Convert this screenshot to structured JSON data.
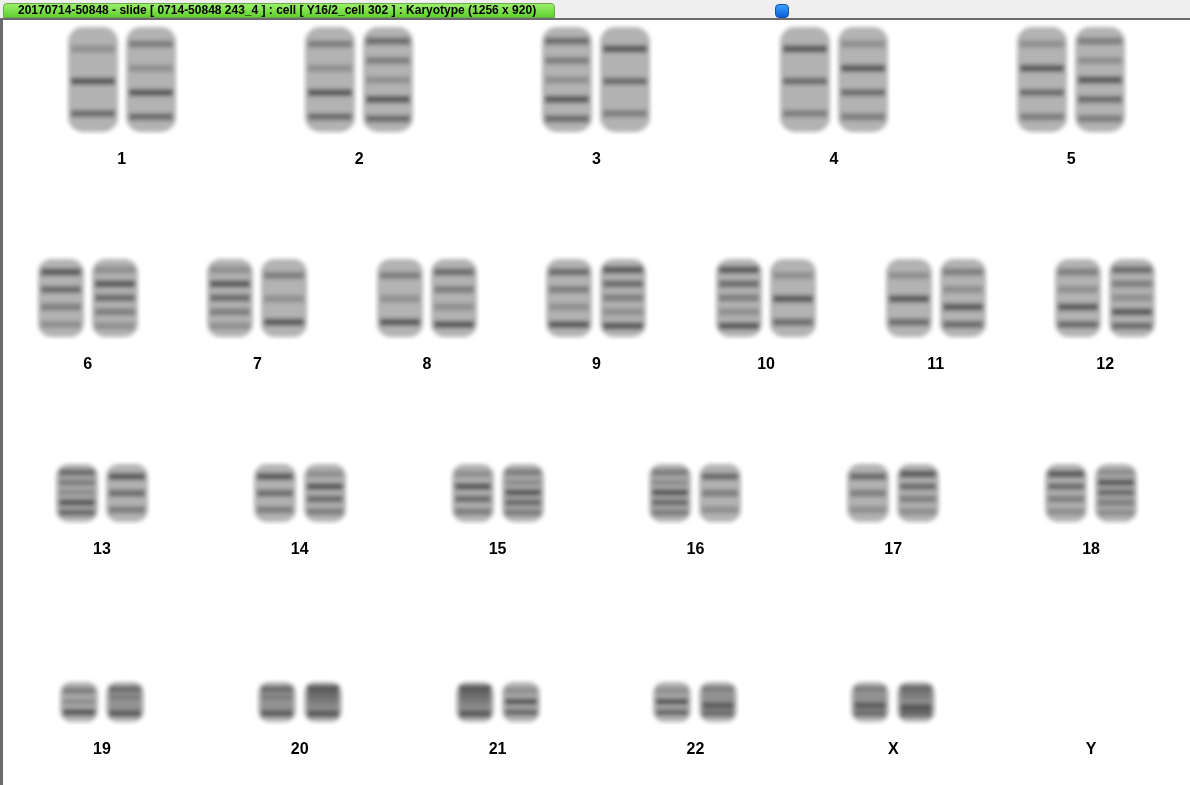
{
  "title_bar": {
    "title": "20170714-50848 - slide [ 0714-50848 243_4 ] : cell [ Y16/2_cell 302 ] : Karyotype  (1256 x 920)"
  },
  "karyotype_rows": [
    [
      {
        "label": "1",
        "kind": "pair"
      },
      {
        "label": "2",
        "kind": "pair"
      },
      {
        "label": "3",
        "kind": "pair"
      },
      {
        "label": "4",
        "kind": "pair"
      },
      {
        "label": "5",
        "kind": "pair"
      }
    ],
    [
      {
        "label": "6",
        "kind": "pair"
      },
      {
        "label": "7",
        "kind": "pair"
      },
      {
        "label": "8",
        "kind": "pair"
      },
      {
        "label": "9",
        "kind": "pair"
      },
      {
        "label": "10",
        "kind": "pair"
      },
      {
        "label": "11",
        "kind": "pair"
      },
      {
        "label": "12",
        "kind": "pair"
      }
    ],
    [
      {
        "label": "13",
        "kind": "pair"
      },
      {
        "label": "14",
        "kind": "pair"
      },
      {
        "label": "15",
        "kind": "pair"
      },
      {
        "label": "16",
        "kind": "pair"
      },
      {
        "label": "17",
        "kind": "pair"
      },
      {
        "label": "18",
        "kind": "pair"
      }
    ],
    [
      {
        "label": "19",
        "kind": "pair"
      },
      {
        "label": "20",
        "kind": "pair"
      },
      {
        "label": "21",
        "kind": "pair"
      },
      {
        "label": "22",
        "kind": "pair"
      },
      {
        "label": "X",
        "kind": "pair"
      },
      {
        "label": "Y",
        "kind": "empty"
      }
    ]
  ]
}
